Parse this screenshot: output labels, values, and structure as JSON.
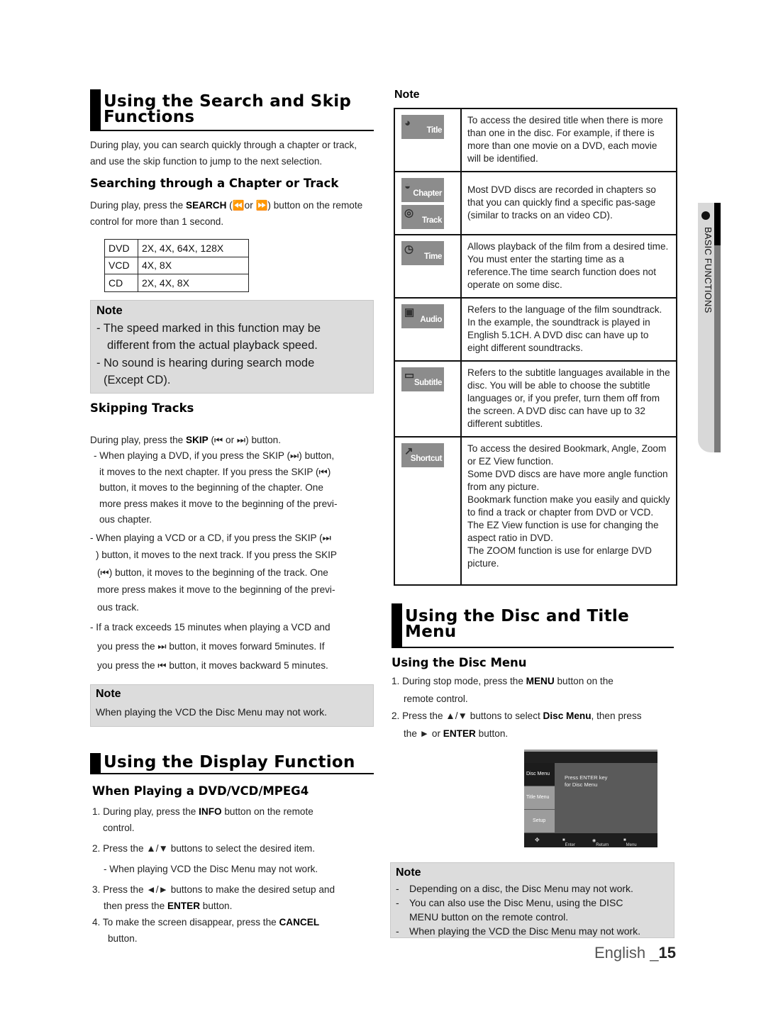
{
  "search_skip": {
    "title_line1": "Using the Search and Skip",
    "title_line2": "Functions",
    "intro": "During play, you can search quickly through a chapter or track, and use the skip function to jump to the next selection.",
    "searching": {
      "heading": "Searching through a Chapter or Track",
      "text_pre": "During play, press the ",
      "text_bold": "SEARCH",
      "text_post": " (⏪or ⏩) button on the remote control for more than 1 second.",
      "table": [
        {
          "disc": "DVD",
          "speeds": "2X, 4X, 64X, 128X"
        },
        {
          "disc": "VCD",
          "speeds": "4X, 8X"
        },
        {
          "disc": "CD",
          "speeds": "2X, 4X, 8X"
        }
      ]
    },
    "note1": {
      "title": "Note",
      "items": [
        "- The speed marked in this function may be",
        "different from the actual playback speed.",
        "- No sound is hearing during search mode",
        "(Except CD)."
      ]
    },
    "skipping": {
      "heading": "Skipping Tracks",
      "lead_pre": "During play, press the ",
      "lead_bold": "SKIP",
      "lead_post": " (⏮ or ⏭) button.",
      "lines": [
        "- When playing a DVD, if you press the SKIP (⏭) button,",
        "it moves to the next chapter. If you press the SKIP (⏮)",
        "button, it moves to the beginning of the chapter. One",
        "more press makes it move to the beginning of the previ-",
        "ous chapter.",
        "- When playing a VCD or a CD, if you press the SKIP (⏭",
        ") button, it moves to the next track. If you press the SKIP",
        "(⏮) button, it moves to the beginning of the track. One",
        "more press makes it move to the beginning of the previ-",
        "ous track.",
        "- If a track exceeds 15 minutes when playing a VCD and",
        "you press the  ⏭  button, it moves forward 5minutes. If",
        "you press the  ⏮  button, it moves backward 5 minutes."
      ]
    },
    "note2": {
      "title": "Note",
      "text": "When playing the VCD the Disc Menu may not work."
    }
  },
  "display": {
    "title": "Using the Display Function",
    "subheading": "When Playing a DVD/VCD/MPEG4",
    "steps": [
      {
        "pre": "1. During play, press the ",
        "bold": "INFO",
        "post": " button on the remote",
        "cont": "control."
      },
      {
        "pre": "2. Press the ▲/▼ buttons to select the desired item.",
        "bold": "",
        "post": "",
        "cont": ""
      },
      {
        "pre": "- When playing VCD the Disc Menu may not work.",
        "bold": "",
        "post": "",
        "cont": ""
      },
      {
        "pre": "3. Press the ◄/► buttons to make the desired setup and",
        "bold": "",
        "post": "",
        "cont": ""
      },
      {
        "pre": "then press the ",
        "bold": "ENTER",
        "post": " button.",
        "cont": ""
      },
      {
        "pre": "4. To make the screen disappear, press the ",
        "bold": "CANCEL",
        "post": "",
        "cont": "button."
      }
    ],
    "note_title": "Note",
    "functions": [
      {
        "icons": [
          {
            "label": "Title",
            "glyph": "◕",
            "name": "title-icon"
          }
        ],
        "text": "To access the desired title when there is more than one in the disc. For example, if there is more than one movie on a DVD, each movie will be identified."
      },
      {
        "icons": [
          {
            "label": "Chapter",
            "glyph": "◒",
            "name": "chapter-icon"
          },
          {
            "label": "Track",
            "glyph": "◎",
            "name": "track-icon"
          }
        ],
        "text": "Most DVD discs are recorded in chapters so that you can quickly find a specific pas-sage (similar to tracks on an video CD)."
      },
      {
        "icons": [
          {
            "label": "Time",
            "glyph": "◷",
            "name": "time-icon"
          }
        ],
        "text": "Allows playback of the film from a desired time. You must enter the starting time as a reference.The time search function does not operate on some disc."
      },
      {
        "icons": [
          {
            "label": "Audio",
            "glyph": "▣",
            "name": "audio-icon"
          }
        ],
        "text": "Refers to the language of the film soundtrack. In the example, the soundtrack is played in English 5.1CH. A DVD disc can have up to eight different soundtracks."
      },
      {
        "icons": [
          {
            "label": "Subtitle",
            "glyph": "▭",
            "name": "subtitle-icon"
          }
        ],
        "text": "Refers to the subtitle languages available in the disc. You will be able to choose the subtitle languages or, if you prefer, turn them off from the screen. A DVD disc can have up to 32 different subtitles."
      },
      {
        "icons": [
          {
            "label": "Shortcut",
            "glyph": "↗",
            "name": "shortcut-icon"
          }
        ],
        "text": "To access the desired Bookmark, Angle, Zoom or EZ View function.\nSome DVD discs are have more angle function from any picture.\nBookmark function make you easily and quickly to find a track or chapter from DVD or VCD.\nThe EZ View function is use for changing the aspect ratio in DVD.\nThe ZOOM function is use for enlarge DVD picture."
      }
    ]
  },
  "disc_menu": {
    "title_line1": "Using the Disc and Title",
    "title_line2": "Menu",
    "subheading": "Using the Disc Menu",
    "step1_pre": "1. During stop mode, press the ",
    "step1_bold": "MENU",
    "step1_post": " button on the",
    "step1_cont": "remote control.",
    "step2_pre": "2. Press the ▲/▼ buttons to select ",
    "step2_bold": "Disc Menu",
    "step2_post": ", then press",
    "step2_cont_pre": "the ► or ",
    "step2_cont_bold": "ENTER",
    "step2_cont_post": " button.",
    "osd": {
      "items": [
        "Disc Menu",
        "Title Menu",
        "Setup"
      ],
      "message_line1": "Press ENTER key",
      "message_line2": "for Disc Menu",
      "footer": [
        "Enter",
        "Return",
        "Menu"
      ]
    },
    "note": {
      "title": "Note",
      "items": [
        "Depending on a disc, the Disc Menu may not work.",
        "You can also use the Disc Menu, using the DISC MENU button on the remote control.",
        "When playing the VCD the Disc Menu may not work."
      ]
    }
  },
  "side_tab": {
    "label": "BASIC FUNCTIONS"
  },
  "footer": {
    "language": "English _",
    "page": "15"
  }
}
